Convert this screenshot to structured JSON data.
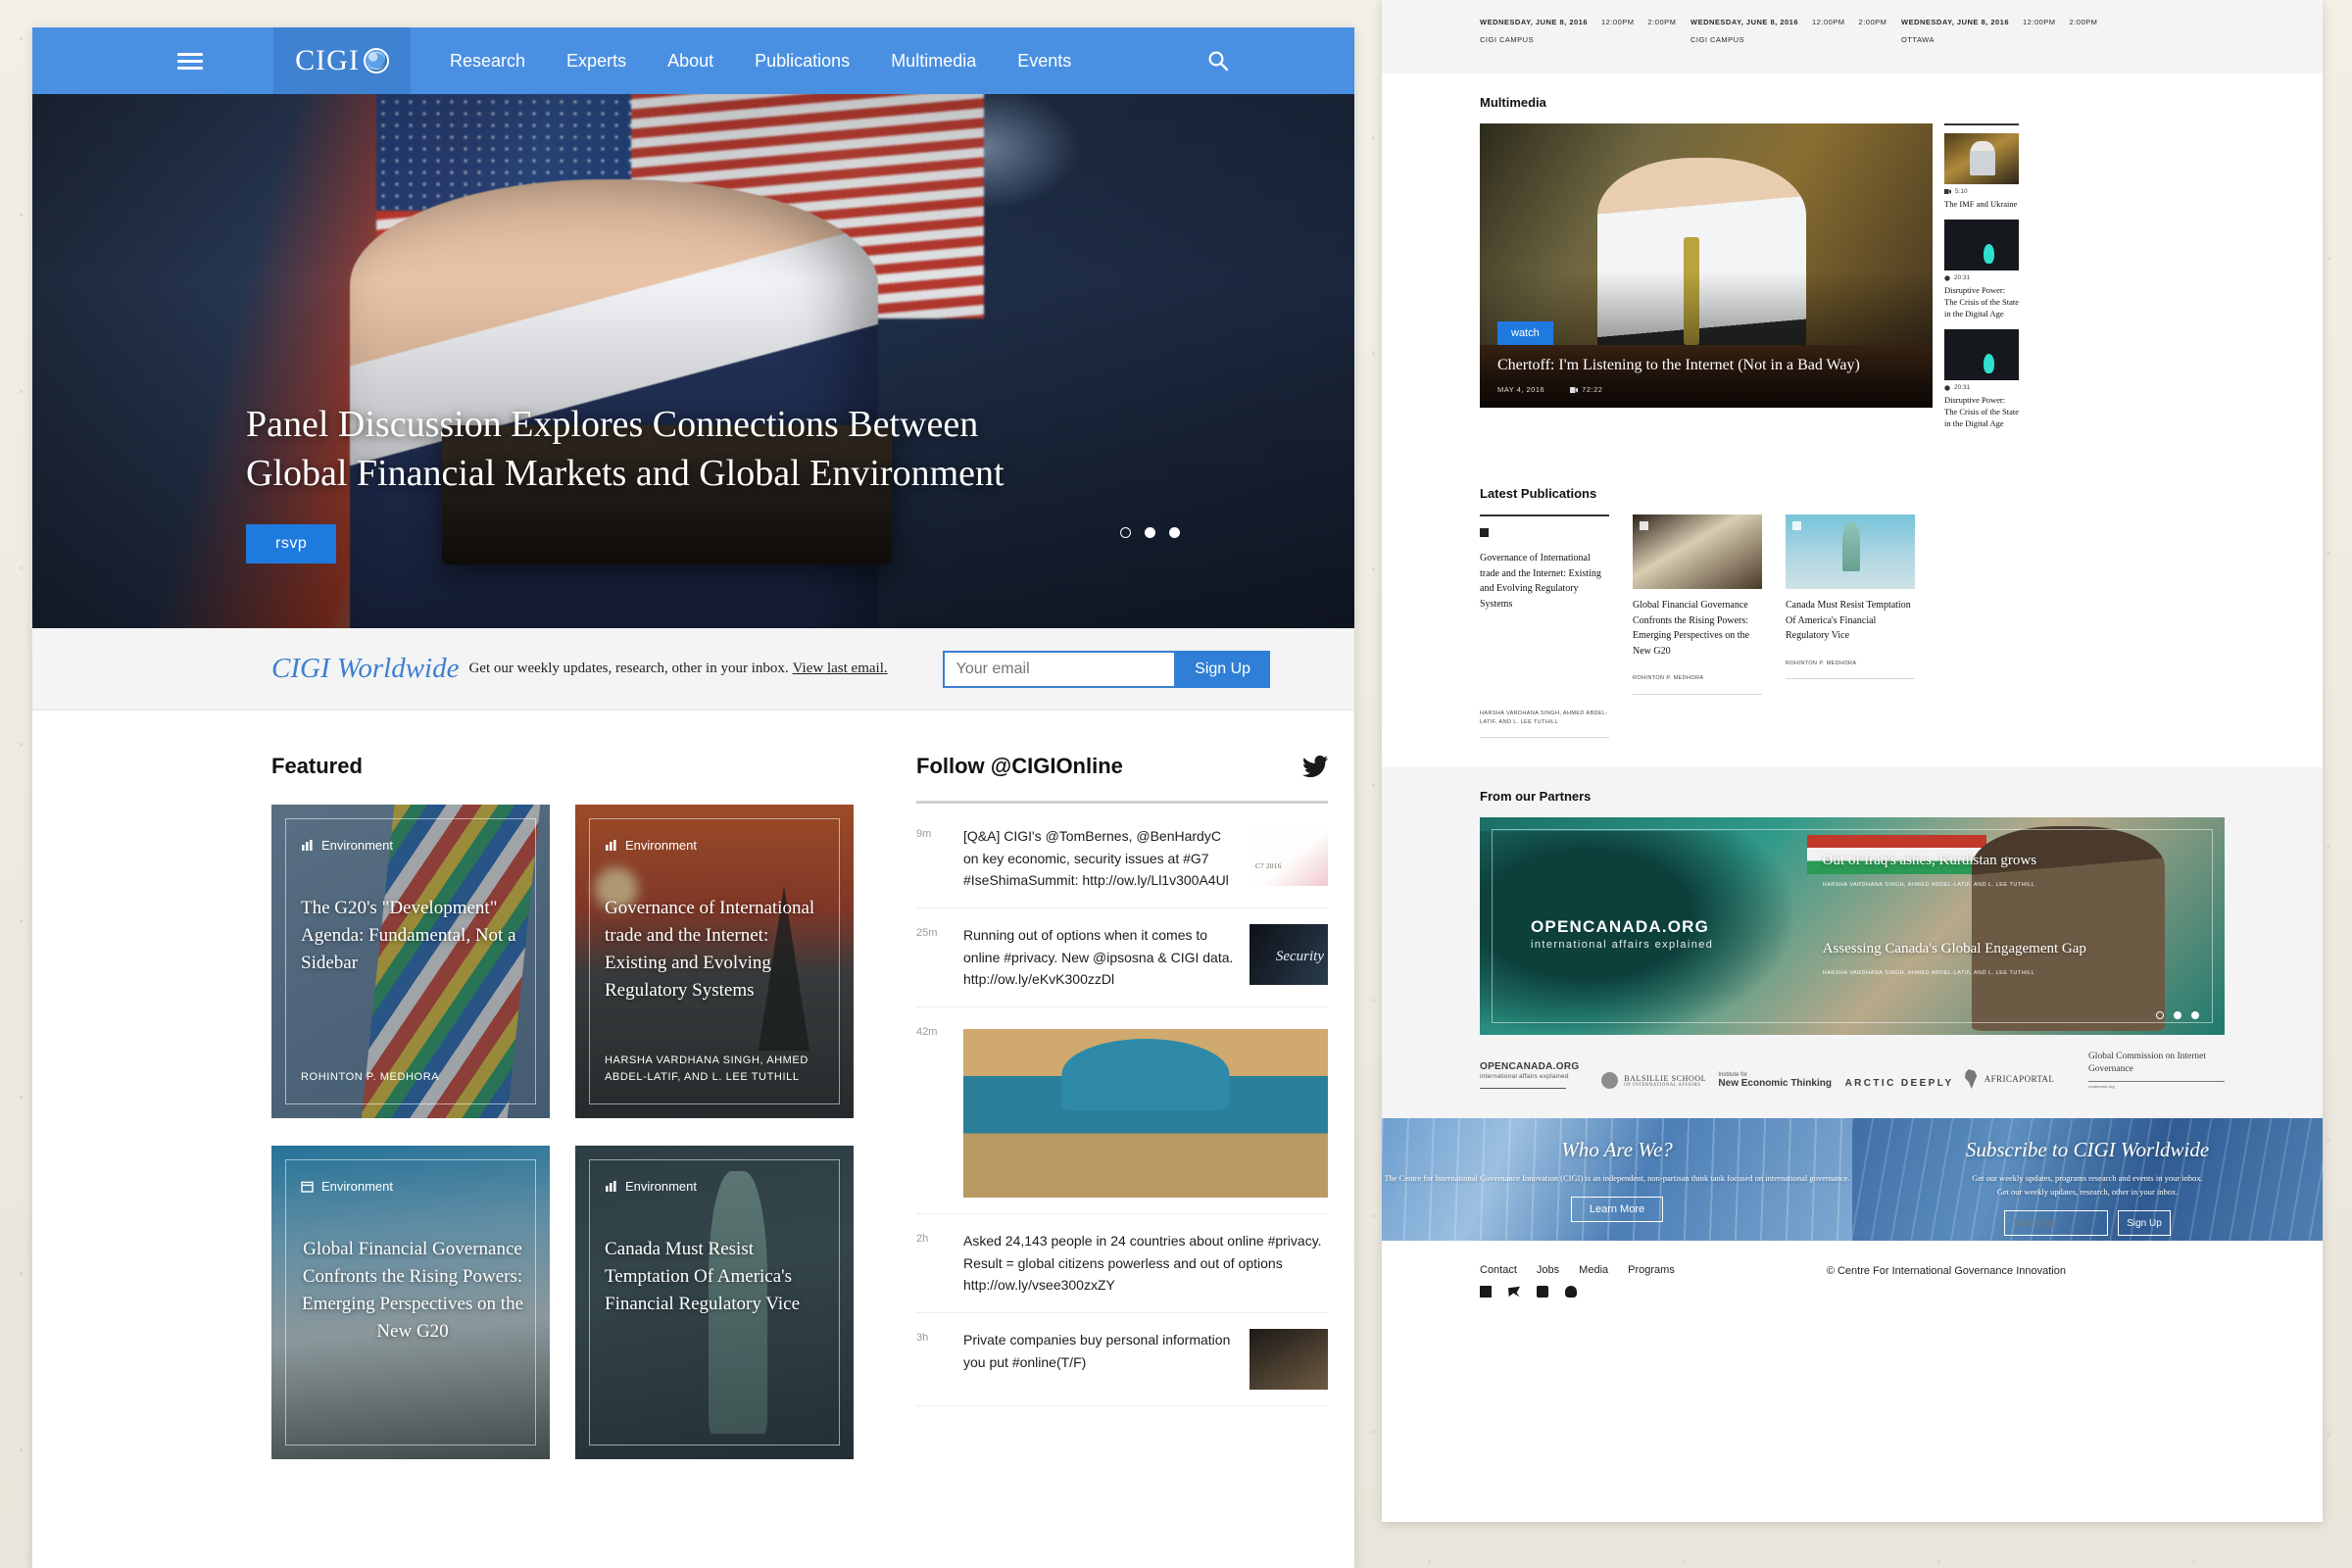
{
  "nav": {
    "logo_text": "CIGI",
    "menu_icon": "hamburger-icon",
    "search_icon": "search-icon",
    "links": [
      "Research",
      "Experts",
      "About",
      "Publications",
      "Multimedia",
      "Events"
    ]
  },
  "hero": {
    "title_line1": "Panel Discussion Explores Connections Between",
    "title_line2": "Global Financial Markets and Global Environment",
    "cta_label": "rsvp",
    "slide_count": 3,
    "active_slide": 2
  },
  "newsletter": {
    "brand": "CIGI Worldwide",
    "blurb": "Get our weekly updates, research, other in your inbox.",
    "link": "View last email.",
    "placeholder": "Your email",
    "button": "Sign Up"
  },
  "featured": {
    "heading": "Featured",
    "cards": [
      {
        "category": "Environment",
        "category_icon": "chart-bar-icon",
        "title": "The G20's \"Development\" Agenda: Fundamental, Not a Sidebar",
        "author": "ROHINTON P. MEDHORA"
      },
      {
        "category": "Environment",
        "category_icon": "chart-bar-icon",
        "title": "Governance of International trade and the Internet: Existing and Evolving Regulatory Systems",
        "author": "HARSHA VARDHANA SINGH, AHMED ABDEL-LATIF, AND L. LEE TUTHILL"
      },
      {
        "category": "Environment",
        "category_icon": "calendar-icon",
        "title": "Global Financial Governance Confronts the Rising Powers: Emerging Perspectives on the New G20",
        "author": ""
      },
      {
        "category": "Environment",
        "category_icon": "chart-bar-icon",
        "title": "Canada Must Resist Temptation Of America's Financial Regulatory Vice",
        "author": ""
      }
    ]
  },
  "twitter": {
    "heading": "Follow @CIGIOnline",
    "icon": "twitter-bird-icon",
    "tweets": [
      {
        "time": "9m",
        "text": "[Q&A] CIGI's @TomBernes, @BenHardyC on key economic, security issues at #G7 #IseShimaSummit: http://ow.ly/Ll1v300A4Ul",
        "thumb": "c7-ise-shima-summit-thumbnail"
      },
      {
        "time": "25m",
        "text": "Running out of options when it comes to online #privacy. New @ipsosna & CIGI data. http://ow.ly/eKvK300zzDl",
        "thumb": "online-security-thumbnail"
      },
      {
        "time": "42m",
        "text": "",
        "thumb": "samarkand-mosque-wide-thumbnail"
      },
      {
        "time": "2h",
        "text": "Asked 24,143 people in 24 countries about online #privacy.  Result = global citizens powerless and out of options http://ow.ly/vsee300zxZY",
        "thumb": ""
      },
      {
        "time": "3h",
        "text": "Private companies buy personal information you put #online(T/F)",
        "thumb": "businessman-thumbnail"
      }
    ]
  },
  "events": [
    {
      "date": "WEDNESDAY, JUNE 8, 2016",
      "start": "12:00PM",
      "end": "2:00PM",
      "location": "CIGI CAMPUS"
    },
    {
      "date": "WEDNESDAY, JUNE 8, 2016",
      "start": "12:00PM",
      "end": "2:00PM",
      "location": "CIGI CAMPUS"
    },
    {
      "date": "WEDNESDAY, JUNE 8, 2016",
      "start": "12:00PM",
      "end": "2:00PM",
      "location": "OTTAWA"
    }
  ],
  "multimedia": {
    "heading": "Multimedia",
    "feature": {
      "watch_label": "watch",
      "title": "Chertoff: I'm Listening to the Internet (Not in a Bad Way)",
      "date": "MAY 4, 2016",
      "duration": "72:22",
      "duration_icon": "video-camera-icon"
    },
    "items": [
      {
        "duration": "5:10",
        "icon": "video-camera-icon",
        "title": "The IMF and Ukraine",
        "thumb": "imf-lagarde-thumbnail"
      },
      {
        "duration": "20:31",
        "icon": "audio-icon",
        "title": "Disruptive Power: The Crisis of the State in the Digital Age",
        "thumb": "crowd-digital-thumbnail"
      },
      {
        "duration": "20:31",
        "icon": "audio-icon",
        "title": "Disruptive Power: The Crisis of the State in the Digital Age",
        "thumb": "crowd-digital-thumbnail"
      }
    ]
  },
  "publications": {
    "heading": "Latest Publications",
    "items": [
      {
        "title": "Governance of International trade and the Internet: Existing and Evolving Regulatory Systems",
        "author": "HARSHA VARDHANA SINGH, AHMED ABDEL-LATIF, AND L. LEE TUTHILL",
        "thumb": ""
      },
      {
        "title": "Global Financial Governance Confronts the Rising Powers: Emerging Perspectives on the New G20",
        "author": "ROHINTON P. MEDHORA",
        "thumb": "open-book-thumbnail"
      },
      {
        "title": "Canada Must Resist Temptation Of America's Financial Regulatory Vice",
        "author": "ROHINTON P. MEDHORA",
        "thumb": "statue-of-liberty-thumbnail"
      }
    ]
  },
  "partners": {
    "heading": "From our Partners",
    "logo_main": "OPENCANADA.ORG",
    "logo_tagline": "international affairs explained",
    "stories": [
      {
        "title": "Out of Iraq's ashes, Kurdistan grows",
        "author": "HARSHA VARDHANA SINGH, AHMED ABDEL-LATIF, AND L. LEE TUTHILL"
      },
      {
        "title": "Assessing Canada's Global Engagement Gap",
        "author": "HARSHA VARDHANA SINGH, AHMED ABDEL-LATIF, AND L. LEE TUTHILL"
      }
    ],
    "slide_count": 3,
    "active_slide": 1,
    "logos": [
      {
        "name": "OPENCANADA.ORG",
        "sub": "international affairs explained"
      },
      {
        "name": "BALSILLIE SCHOOL",
        "sub": "OF INTERNATIONAL AFFAIRS"
      },
      {
        "name": "New Economic Thinking",
        "sub": "Institute for"
      },
      {
        "name": "ARCTIC DEEPLY",
        "sub": ""
      },
      {
        "name": "AFRICAPORTAL",
        "sub": ""
      },
      {
        "name": "Global Commission on Internet Governance",
        "sub": "ourinternet.org"
      }
    ]
  },
  "cta": {
    "who": {
      "title": "Who Are We?",
      "body": "The Centre for International Governance Innovation (CIGI) is an independent, non-partisan think tank focused on international governance.",
      "button": "Learn More"
    },
    "subscribe": {
      "title": "Subscribe to CIGI Worldwide",
      "body_line1": "Get our weekly updates, programs research and events in your inbox.",
      "body_line2": "Get our weekly updates, research, other in your inbox.",
      "placeholder": "Your email",
      "button": "Sign Up"
    }
  },
  "footer": {
    "links": [
      "Contact",
      "Jobs",
      "Media",
      "Programs"
    ],
    "social": [
      "facebook-icon",
      "twitter-icon",
      "youtube-icon",
      "rss-icon"
    ],
    "copyright": "© Centre For International Governance Innovation"
  },
  "colors": {
    "brand_blue": "#4a90e2",
    "accent_blue": "#1f7ae0",
    "panel_bg": "#f4f4f4"
  }
}
